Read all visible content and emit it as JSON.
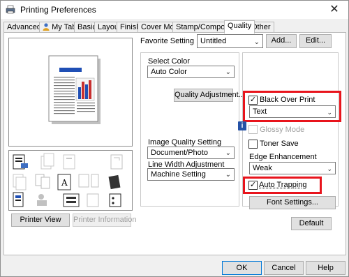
{
  "window": {
    "title": "Printing Preferences",
    "close_glyph": "✕"
  },
  "tabs": [
    {
      "label": "Advanced"
    },
    {
      "label": "My Tab"
    },
    {
      "label": "Basic"
    },
    {
      "label": "Layout"
    },
    {
      "label": "Finish"
    },
    {
      "label": "Cover Mode"
    },
    {
      "label": "Stamp/Composition"
    },
    {
      "label": "Quality",
      "active": true
    },
    {
      "label": "Other"
    }
  ],
  "favorite": {
    "label": "Favorite Setting",
    "value": "Untitled",
    "add_label": "Add...",
    "edit_label": "Edit..."
  },
  "left": {
    "printer_view_label": "Printer View",
    "printer_info_label": "Printer Information"
  },
  "quality": {
    "select_color_label": "Select Color",
    "select_color_value": "Auto Color",
    "quality_adjustment_label": "Quality Adjustment...",
    "image_quality_label": "Image Quality Setting",
    "image_quality_value": "Document/Photo",
    "line_width_label": "Line Width Adjustment",
    "line_width_value": "Machine Setting"
  },
  "right": {
    "black_over_print_label": "Black Over Print",
    "black_over_print_checked": true,
    "black_over_print_value": "Text",
    "glossy_mode_label": "Glossy Mode",
    "toner_save_label": "Toner Save",
    "edge_enhancement_label": "Edge Enhancement",
    "edge_enhancement_value": "Weak",
    "auto_trapping_label": "Auto Trapping",
    "auto_trapping_checked": true,
    "font_settings_label": "Font Settings...",
    "default_label": "Default"
  },
  "footer": {
    "ok_label": "OK",
    "cancel_label": "Cancel",
    "help_label": "Help"
  },
  "colors": {
    "highlight_red": "#e8141c",
    "info_blue": "#2452a6",
    "chart_blue": "#1f4fb5",
    "chart_red": "#c83030"
  }
}
